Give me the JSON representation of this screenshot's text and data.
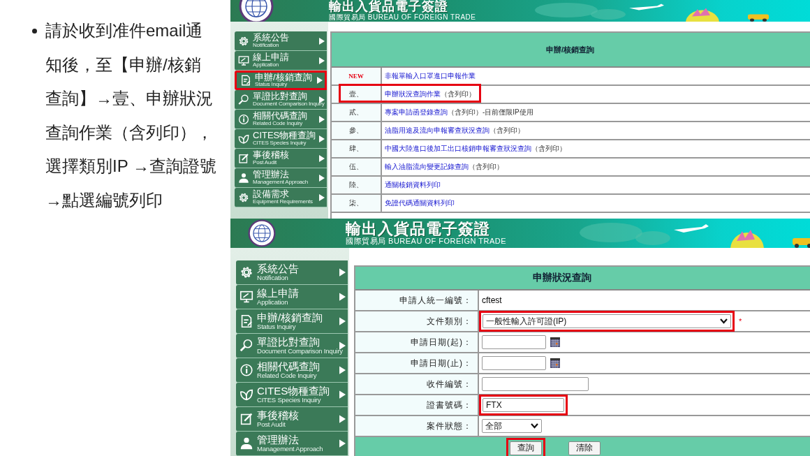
{
  "instructions": {
    "lines": [
      "請於收到准件email通",
      "知後，至【申辦/核銷",
      "查詢】→壹、申辦狀況",
      "查詢作業（含列印），",
      "選擇類別IP →查詢證號",
      "→點選編號列印"
    ]
  },
  "screens": [
    {
      "kind": "menu",
      "banner": {
        "title": "輸出入貨品電子簽證",
        "subtitle": "國際貿易局 BUREAU OF FOREIGN TRADE"
      },
      "sidebar": [
        {
          "title": "系統公告",
          "subtitle": "Notification",
          "highlighted": false
        },
        {
          "title": "線上申請",
          "subtitle": "Application",
          "highlighted": false
        },
        {
          "title": "申辦/核銷查詢",
          "subtitle": "Status Inquiry",
          "highlighted": true
        },
        {
          "title": "單證比對查詢",
          "subtitle": "Document Comparison Inquiry",
          "highlighted": false
        },
        {
          "title": "相關代碼查詢",
          "subtitle": "Related Code Inquiry",
          "highlighted": false
        },
        {
          "title": "CITES物種查詢",
          "subtitle": "CITES Species Inquiry",
          "highlighted": false
        },
        {
          "title": "事後稽核",
          "subtitle": "Post Audit",
          "highlighted": false
        },
        {
          "title": "管理辦法",
          "subtitle": "Management Approach",
          "highlighted": false
        },
        {
          "title": "設備需求",
          "subtitle": "Equipment Requirements",
          "highlighted": false
        }
      ],
      "panel": {
        "title": "申辦/核銷查詢",
        "rows": [
          {
            "kind": "new",
            "marker": "NEW",
            "link": "非報單輸入口罩進口申報作業",
            "highlighted": false
          },
          {
            "kind": "number",
            "marker": "壹、",
            "link": "申辦狀況查詢作業",
            "note": "（含列印）",
            "highlighted": true
          },
          {
            "kind": "number",
            "marker": "貳、",
            "link": "專案申請函登錄查詢",
            "note": "（含列印）-目前僅限IP使用",
            "highlighted": false
          },
          {
            "kind": "number",
            "marker": "參、",
            "link": "油脂用途及流向申報審查狀況查詢",
            "note": "（含列印）",
            "highlighted": false
          },
          {
            "kind": "number",
            "marker": "肆、",
            "link": "中國大陸進口後加工出口核銷申報審查狀況查詢",
            "note": "（含列印）",
            "highlighted": false
          },
          {
            "kind": "number",
            "marker": "伍、",
            "link": "輸入油脂流向變更記錄查詢",
            "note": "（含列印）",
            "highlighted": false
          },
          {
            "kind": "number",
            "marker": "陸、",
            "link": "通關核銷資料列印",
            "highlighted": false
          },
          {
            "kind": "number",
            "marker": "柒、",
            "link": "免證代碼通關資料列印",
            "highlighted": false
          }
        ]
      }
    },
    {
      "kind": "form",
      "banner": {
        "title": "輸出入貨品電子簽證",
        "subtitle": "國際貿易局 BUREAU OF FOREIGN TRADE"
      },
      "sidebar": [
        {
          "title": "系統公告",
          "subtitle": "Notification",
          "highlighted": false
        },
        {
          "title": "線上申請",
          "subtitle": "Application",
          "highlighted": false
        },
        {
          "title": "申辦/核銷查詢",
          "subtitle": "Status Inquiry",
          "highlighted": false
        },
        {
          "title": "單證比對查詢",
          "subtitle": "Document Comparison Inquiry",
          "highlighted": false
        },
        {
          "title": "相關代碼查詢",
          "subtitle": "Related Code Inquiry",
          "highlighted": false
        },
        {
          "title": "CITES物種查詢",
          "subtitle": "CITES Species Inquiry",
          "highlighted": false
        },
        {
          "title": "事後稽核",
          "subtitle": "Post Audit",
          "highlighted": false
        },
        {
          "title": "管理辦法",
          "subtitle": "Management Approach",
          "highlighted": false
        }
      ],
      "form": {
        "title": "申辦狀況查詢",
        "fields": [
          {
            "kind": "text",
            "label": "申請人統一編號：",
            "value": "cftest",
            "highlighted": false
          },
          {
            "kind": "select",
            "label": "文件類別：",
            "value": "一般性輸入許可證(IP)",
            "required_mark": "*",
            "highlighted": true
          },
          {
            "kind": "date",
            "label": "申請日期(起)：",
            "highlighted": false
          },
          {
            "kind": "date",
            "label": "申請日期(止)：",
            "highlighted": false
          },
          {
            "kind": "input",
            "label": "收件編號：",
            "highlighted": false
          },
          {
            "kind": "input",
            "label": "證書號碼：",
            "value": "FTX",
            "highlighted": true
          },
          {
            "kind": "select",
            "label": "案件狀態：",
            "value": "全部",
            "highlighted": false
          }
        ],
        "buttons": [
          {
            "label": "查詢",
            "highlighted": true
          },
          {
            "label": "清除",
            "highlighted": false
          }
        ]
      }
    }
  ]
}
